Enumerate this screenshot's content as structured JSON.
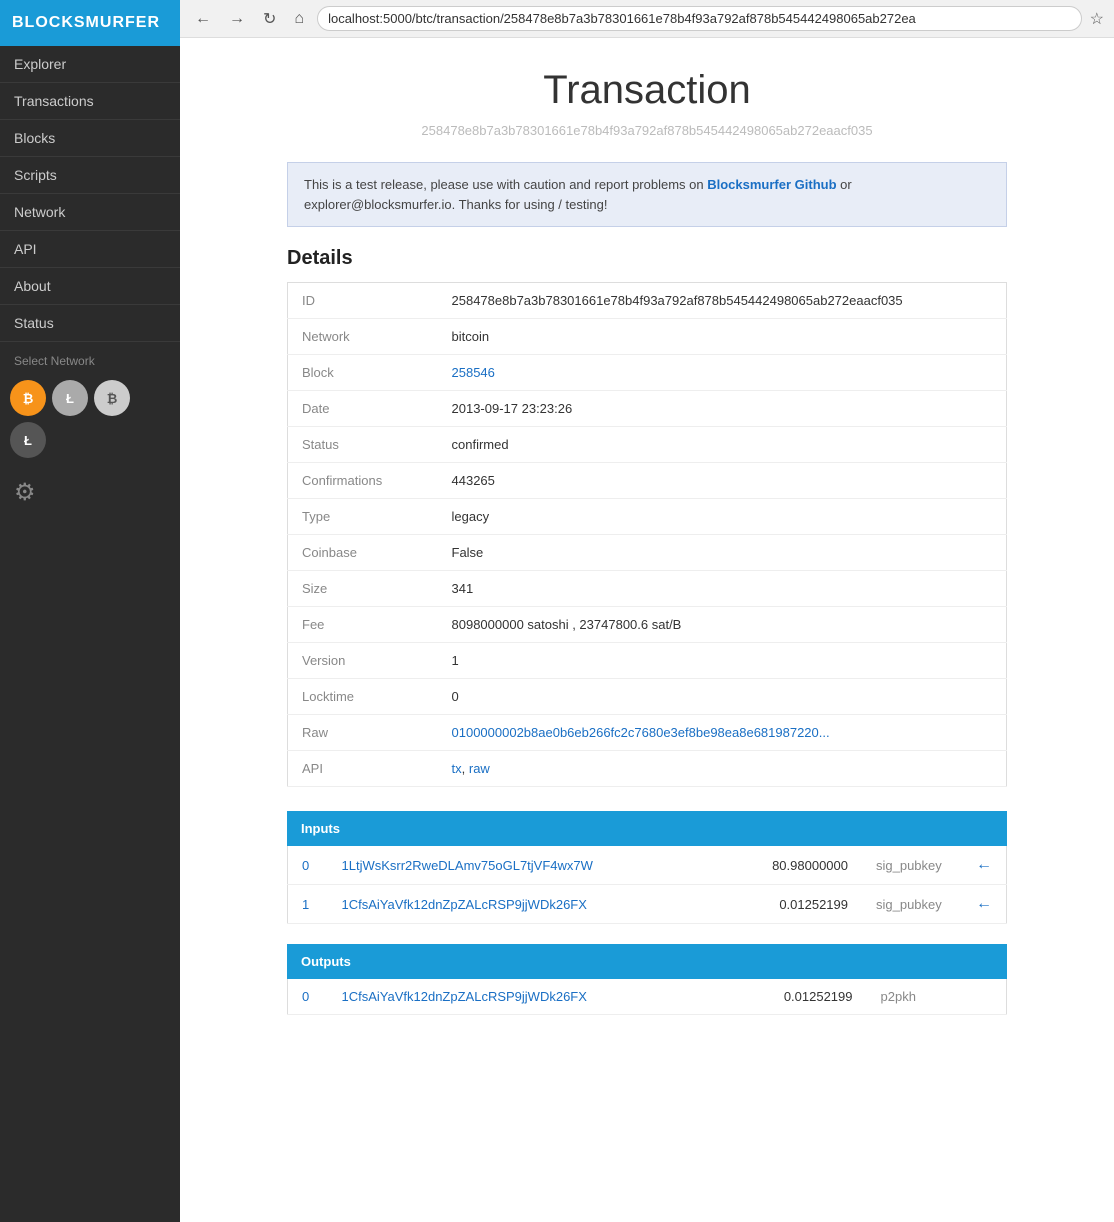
{
  "browser": {
    "url": "localhost:5000/btc/transaction/258478e8b7a3b78301661e78b4f93a792af878b545442498065ab272ea"
  },
  "sidebar": {
    "logo": "BLOCKSMURFER",
    "nav_items": [
      {
        "label": "Explorer",
        "id": "explorer"
      },
      {
        "label": "Transactions",
        "id": "transactions"
      },
      {
        "label": "Blocks",
        "id": "blocks"
      },
      {
        "label": "Scripts",
        "id": "scripts"
      },
      {
        "label": "Network",
        "id": "network"
      },
      {
        "label": "API",
        "id": "api"
      },
      {
        "label": "About",
        "id": "about"
      },
      {
        "label": "Status",
        "id": "status"
      }
    ],
    "select_network_label": "Select Network",
    "networks": [
      {
        "id": "bitcoin",
        "label": "B",
        "class": "bitcoin"
      },
      {
        "id": "litecoin",
        "label": "Ł",
        "class": "litecoin"
      },
      {
        "id": "bitcoin-light",
        "label": "B",
        "class": "bitcoin-light"
      },
      {
        "id": "litecoin-dark",
        "label": "Ł",
        "class": "litecoin-dark"
      }
    ]
  },
  "page": {
    "title": "Transaction",
    "tx_hash": "258478e8b7a3b78301661e78b4f93a792af878b545442498065ab272eaacf035",
    "notice": "This is a test release, please use with caution and report problems on ",
    "notice_link_text": "Blocksmurfer Github",
    "notice_end": " or explorer@blocksmurfer.io. Thanks for using / testing!",
    "details_title": "Details"
  },
  "details": {
    "rows": [
      {
        "label": "ID",
        "value": "258478e8b7a3b78301661e78b4f93a792af878b545442498065ab272eaacf035",
        "link": null
      },
      {
        "label": "Network",
        "value": "bitcoin",
        "link": null
      },
      {
        "label": "Block",
        "value": "258546",
        "link": "/btc/block/258546"
      },
      {
        "label": "Date",
        "value": "2013-09-17 23:23:26",
        "link": null
      },
      {
        "label": "Status",
        "value": "confirmed",
        "link": null
      },
      {
        "label": "Confirmations",
        "value": "443265",
        "link": null
      },
      {
        "label": "Type",
        "value": "legacy",
        "link": null
      },
      {
        "label": "Coinbase",
        "value": "False",
        "link": null
      },
      {
        "label": "Size",
        "value": "341",
        "link": null
      },
      {
        "label": "Fee",
        "value": "8098000000 satoshi , 23747800.6 sat/B",
        "link": null
      },
      {
        "label": "Version",
        "value": "1",
        "link": null
      },
      {
        "label": "Locktime",
        "value": "0",
        "link": null
      },
      {
        "label": "Raw",
        "value": "0100000002b8ae0b6eb266fc2c7680e3ef8be98ea8e681987220...",
        "link": "/btc/tx/raw"
      },
      {
        "label": "API",
        "value": null,
        "links": [
          {
            "text": "tx",
            "href": "/api/tx"
          },
          {
            "text": "raw",
            "href": "/api/raw"
          }
        ]
      }
    ]
  },
  "inputs": {
    "header": "Inputs",
    "rows": [
      {
        "idx": "0",
        "address": "1LtjWsKsrr2RweDLAmv75oGL7tjVF4wx7W",
        "amount": "80.98000000",
        "type": "sig_pubkey",
        "has_arrow": true
      },
      {
        "idx": "1",
        "address": "1CfsAiYaVfk12dnZpZALcRSP9jjWDk26FX",
        "amount": "0.01252199",
        "type": "sig_pubkey",
        "has_arrow": true
      }
    ]
  },
  "outputs": {
    "header": "Outputs",
    "rows": [
      {
        "idx": "0",
        "address": "1CfsAiYaVfk12dnZpZALcRSP9jjWDk26FX",
        "amount": "0.01252199",
        "type": "p2pkh",
        "has_arrow": false
      }
    ]
  }
}
